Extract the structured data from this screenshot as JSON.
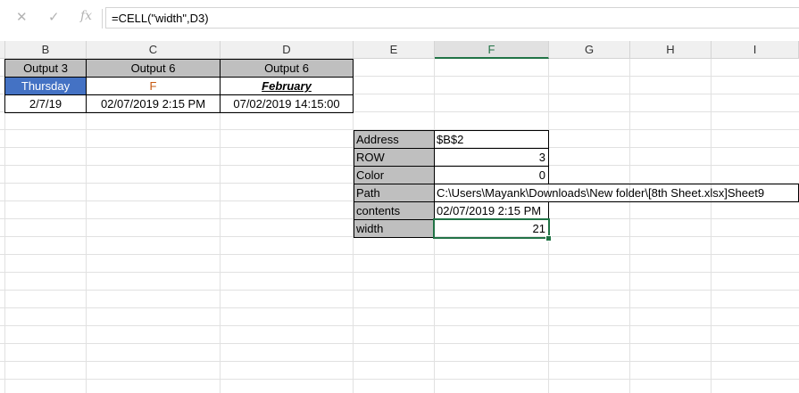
{
  "formula_bar": {
    "cancel_glyph": "✕",
    "enter_glyph": "✓",
    "fx_glyph": "fx",
    "formula": "=CELL(\"width\",D3)"
  },
  "columns": [
    "B",
    "C",
    "D",
    "E",
    "F",
    "G",
    "H",
    "I"
  ],
  "selected_column": "F",
  "table1": {
    "headers": [
      "Output 3",
      "Output 6",
      "Output 6"
    ],
    "row2": [
      "Thursday",
      "F",
      "February"
    ],
    "row3": [
      "2/7/19",
      "02/07/2019 2:15 PM",
      "07/02/2019 14:15:00"
    ]
  },
  "table2": [
    {
      "label": "Address",
      "value": "$B$2"
    },
    {
      "label": "ROW",
      "value": "3"
    },
    {
      "label": "Color",
      "value": "0"
    },
    {
      "label": "Path",
      "value": "C:\\Users\\Mayank\\Downloads\\New folder\\[8th Sheet.xlsx]Sheet9"
    },
    {
      "label": "contents",
      "value": "02/07/2019 2:15 PM"
    },
    {
      "label": "width",
      "value": "21"
    }
  ],
  "colors": {
    "accent_green": "#217346",
    "header_gray": "#bfbfbf",
    "thursday_blue": "#4472c4",
    "f_orange": "#c65911"
  }
}
